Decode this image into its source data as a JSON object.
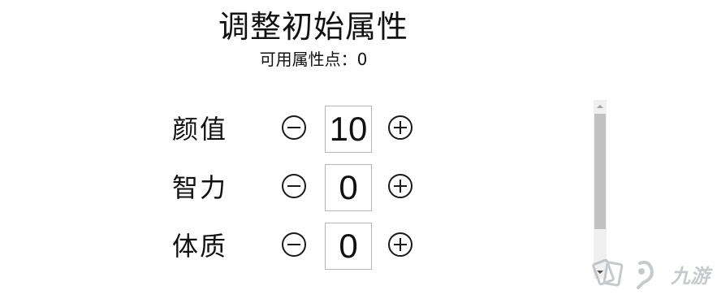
{
  "header": {
    "title": "调整初始属性",
    "available_points_label": "可用属性点：",
    "available_points_value": "0"
  },
  "attributes": [
    {
      "label": "颜值",
      "value": "10"
    },
    {
      "label": "智力",
      "value": "0"
    },
    {
      "label": "体质",
      "value": "0"
    }
  ],
  "icons": {
    "decrease": "minus-circle-icon",
    "increase": "plus-circle-icon"
  },
  "watermark": {
    "text": "九游"
  }
}
